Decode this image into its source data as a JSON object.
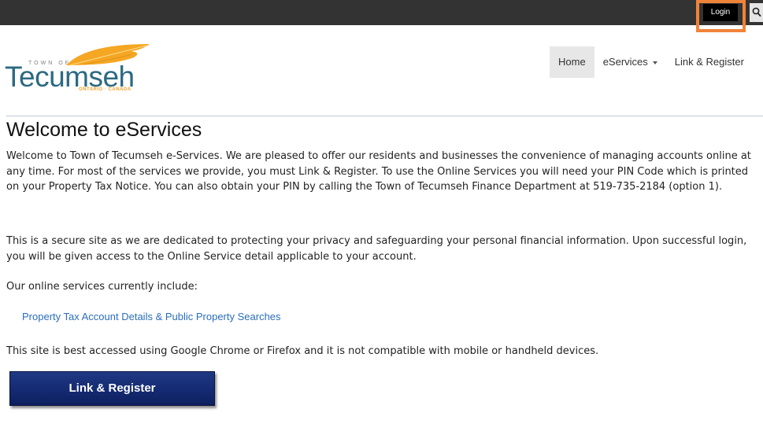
{
  "header": {
    "login_label": "Login",
    "search_icon": "search-icon"
  },
  "logo": {
    "town_of": "TOWN OF",
    "name": "Tecumseh",
    "province": "ONTARIO · CANADA"
  },
  "nav": {
    "home": "Home",
    "eservices": "eServices",
    "link_register": "Link & Register"
  },
  "main": {
    "title": "Welcome to eServices",
    "intro": "Welcome to Town of Tecumseh e-Services.  We are pleased to offer our residents and businesses the convenience of managing accounts online at any time.  For most of the services we provide, you must Link & Register.  To use the Online Services you will need your PIN Code which is printed on your Property Tax Notice.  You can also obtain your PIN by calling the Town of Tecumseh Finance Department at 519-735-2184 (option 1).",
    "secure_text": "This is a secure site as we are dedicated to protecting your privacy and safeguarding your personal financial information.  Upon successful login, you will be given access to the Online Service detail applicable to your account.",
    "services_intro": "Our online services currently include:",
    "service_link": "Property Tax Account Details & Public Property Searches",
    "browser_note": "This site is best accessed using Google Chrome or Firefox and it is not compatible with mobile or handheld devices.",
    "register_button": "Link & Register"
  },
  "colors": {
    "topbar": "#333333",
    "highlight": "#f0833a",
    "link": "#2a6ebb",
    "button": "#142a72",
    "logo_text": "#2c6a82",
    "logo_accent": "#f2a12a"
  }
}
